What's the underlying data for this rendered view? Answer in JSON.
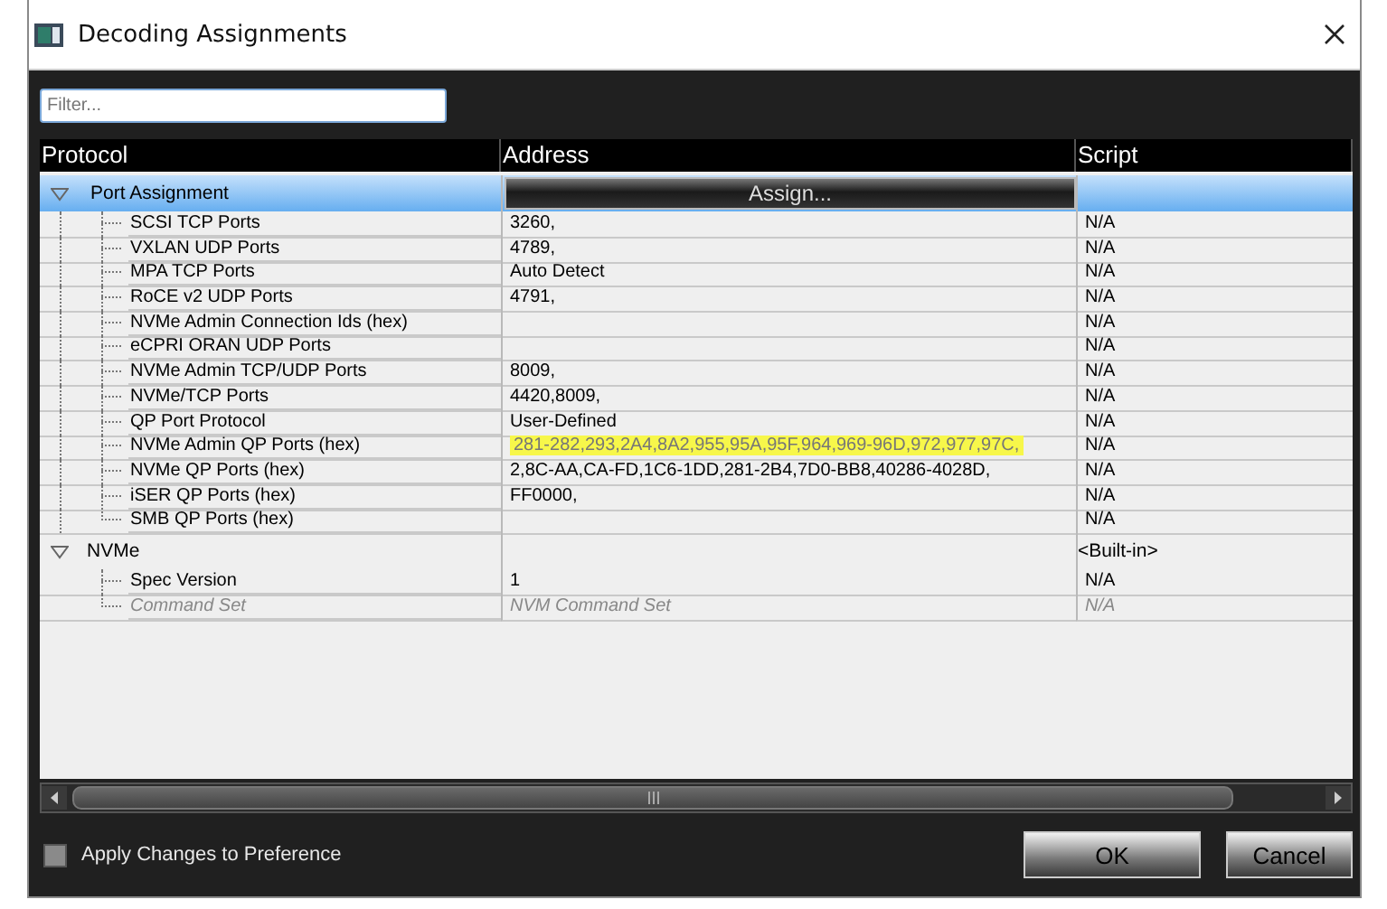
{
  "window": {
    "title": "Decoding Assignments"
  },
  "filter": {
    "placeholder": "Filter..."
  },
  "columns": [
    "Protocol",
    "Address",
    "Script"
  ],
  "groups": [
    {
      "label": "Port Assignment",
      "expanded": true,
      "selected": true,
      "action": "Assign...",
      "children": [
        {
          "label": "SCSI TCP Ports",
          "address": "3260,",
          "script": "N/A"
        },
        {
          "label": "VXLAN UDP Ports",
          "address": "4789,",
          "script": "N/A"
        },
        {
          "label": "MPA TCP Ports",
          "address": "Auto Detect",
          "script": "N/A"
        },
        {
          "label": "RoCE v2 UDP Ports",
          "address": "4791,",
          "script": "N/A"
        },
        {
          "label": "NVMe Admin Connection Ids (hex)",
          "script": "N/A"
        },
        {
          "label": "eCPRI ORAN UDP Ports",
          "script": "N/A"
        },
        {
          "label": "NVMe Admin TCP/UDP Ports",
          "address": "8009,",
          "script": "N/A"
        },
        {
          "label": "NVMe/TCP Ports",
          "address": "4420,8009,",
          "script": "N/A"
        },
        {
          "label": "QP Port Protocol",
          "address": "User-Defined",
          "script": "N/A"
        },
        {
          "label": "NVMe Admin QP Ports (hex)",
          "address": "281-282,293,2A4,8A2,955,95A,95F,964,969-96D,972,977,97C,",
          "script": "N/A",
          "highlighted": true
        },
        {
          "label": "NVMe QP Ports (hex)",
          "address": "2,8C-AA,CA-FD,1C6-1DD,281-2B4,7D0-BB8,40286-4028D,",
          "script": "N/A"
        },
        {
          "label": "iSER QP Ports (hex)",
          "address": "FF0000,",
          "script": "N/A"
        },
        {
          "label": "SMB QP Ports (hex)",
          "script": "N/A"
        }
      ]
    },
    {
      "label": "NVMe",
      "expanded": true,
      "selected": false,
      "script": "<Built-in>",
      "children": [
        {
          "label": "Spec Version",
          "address": "1",
          "script": "N/A"
        },
        {
          "label": "Command Set",
          "address": "NVM Command Set",
          "script": "N/A",
          "disabled": true
        }
      ]
    }
  ],
  "apply_changes": {
    "label": "Apply Changes to Preference",
    "checked": false
  },
  "buttons": [
    "OK",
    "Cancel"
  ]
}
